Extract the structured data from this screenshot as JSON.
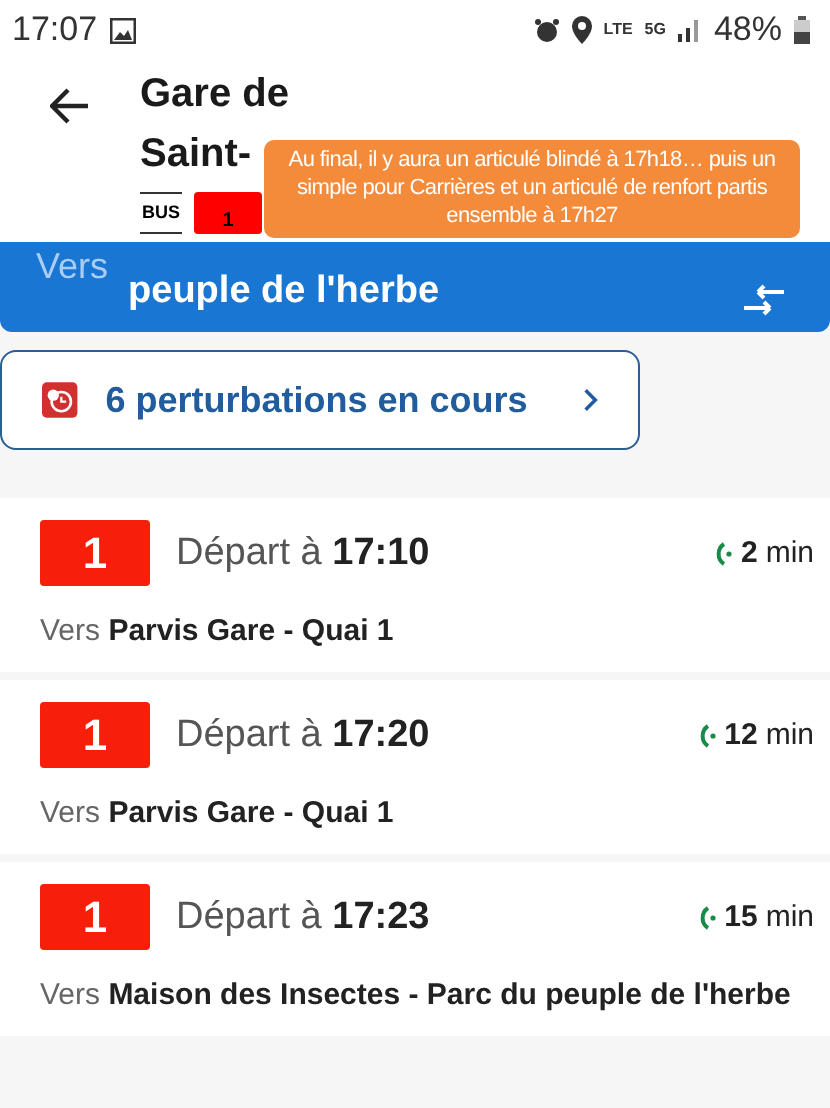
{
  "status_bar": {
    "time": "17:07",
    "network_labels": [
      "LTE",
      "5G"
    ],
    "battery": "48%"
  },
  "header": {
    "title_lines": [
      "Gare de",
      "Saint-"
    ],
    "mode": "BUS",
    "line": {
      "label": "1",
      "color": "#ff0000"
    }
  },
  "direction": {
    "prefix": "Vers",
    "destination_lines": [
      "peuple de l'herbe"
    ]
  },
  "disruptions": {
    "label": "6 perturbations en cours"
  },
  "departures": [
    {
      "line": "1",
      "prefix": "Départ à",
      "time": "17:10",
      "wait_value": "2",
      "wait_unit": "min",
      "to_prefix": "Vers",
      "destination": "Parvis Gare - Quai 1"
    },
    {
      "line": "1",
      "prefix": "Départ à",
      "time": "17:20",
      "wait_value": "12",
      "wait_unit": "min",
      "to_prefix": "Vers",
      "destination": "Parvis Gare - Quai 1"
    },
    {
      "line": "1",
      "prefix": "Départ à",
      "time": "17:23",
      "wait_value": "15",
      "wait_unit": "min",
      "to_prefix": "Vers",
      "destination": "Maison des Insectes - Parc du peuple de l'herbe"
    }
  ],
  "overlay_note": "Au final, il y aura un articulé blindé à 17h18… puis un simple pour Carrières et un articulé de renfort partis ensemble à 17h27"
}
